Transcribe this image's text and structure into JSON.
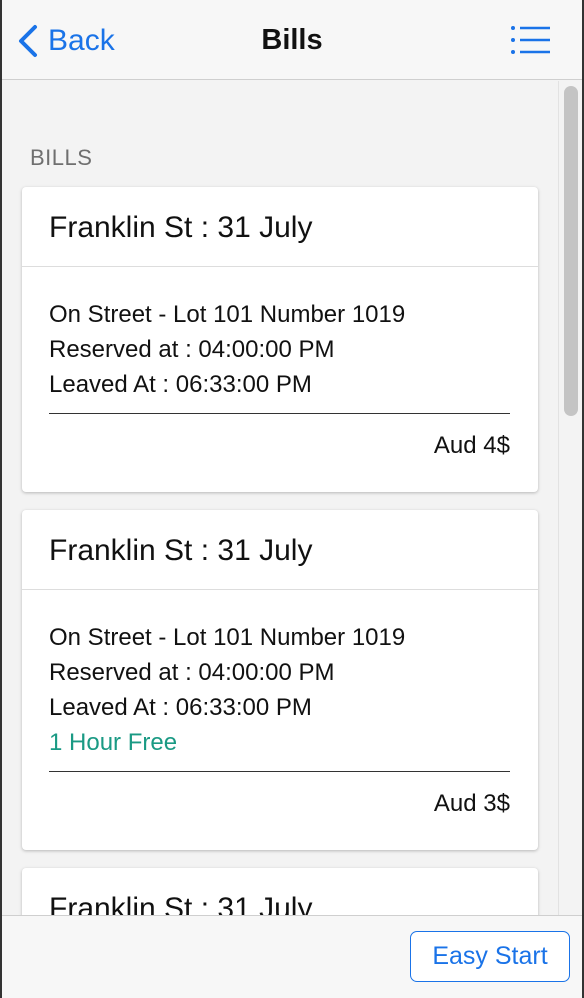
{
  "header": {
    "back_label": "Back",
    "title": "Bills"
  },
  "section": {
    "label": "BILLS"
  },
  "bills": [
    {
      "title": "Franklin St : 31 July",
      "location": "On Street - Lot 101 Number 1019",
      "reserved": "Reserved at : 04:00:00 PM",
      "leaved": "Leaved At : 06:33:00 PM",
      "promo": "",
      "price": "Aud 4$"
    },
    {
      "title": "Franklin St : 31 July",
      "location": "On Street - Lot 101 Number 1019",
      "reserved": "Reserved at : 04:00:00 PM",
      "leaved": "Leaved At : 06:33:00 PM",
      "promo": "1 Hour Free",
      "price": "Aud 3$"
    },
    {
      "title": "Franklin St : 31 July"
    }
  ],
  "footer": {
    "easy_start_label": "Easy Start"
  },
  "colors": {
    "accent": "#1a73e8",
    "promo": "#1a9a84"
  },
  "icons": {
    "back": "chevron-left-icon",
    "menu": "list-icon"
  }
}
